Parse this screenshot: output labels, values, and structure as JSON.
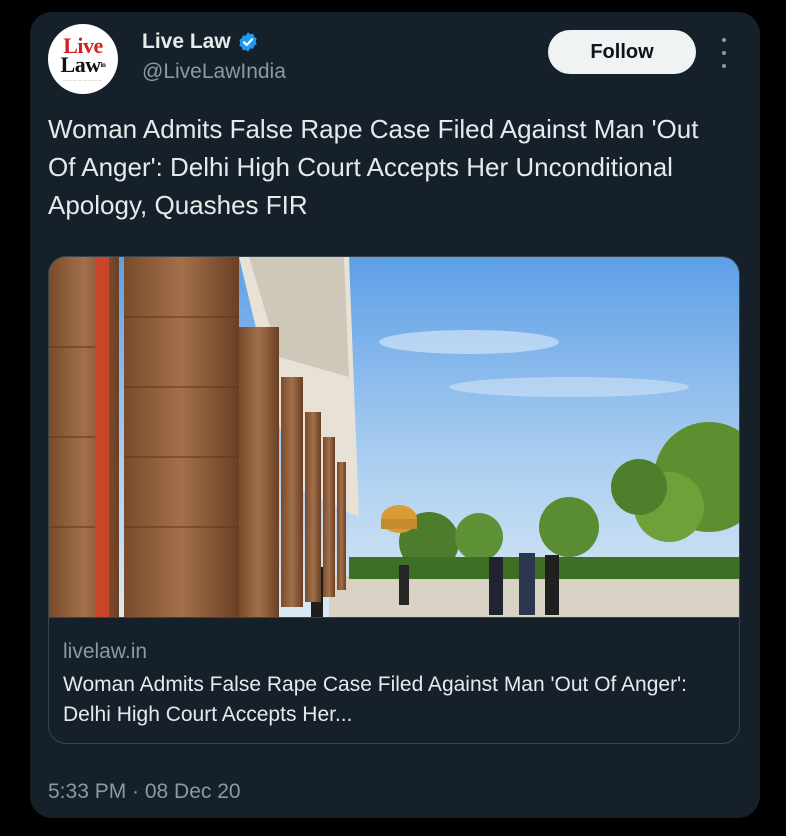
{
  "account": {
    "logo_line1": "Live",
    "logo_line2": "Law",
    "logo_suffix": "in",
    "display_name": "Live Law",
    "handle": "@LiveLawIndia",
    "verified_icon": "verified-badge-icon"
  },
  "actions": {
    "follow_label": "Follow",
    "more_icon": "more-vertical-icon"
  },
  "tweet": {
    "text": "Woman Admits False Rape Case Filed Against Man 'Out Of Anger': Delhi High Court Accepts Her Unconditional Apology, Quashes FIR",
    "timestamp": "5:33 PM · 08 Dec 20"
  },
  "link_card": {
    "domain": "livelaw.in",
    "title": "Woman Admits False Rape Case Filed Against Man 'Out Of Anger': Delhi High Court Accepts Her..."
  },
  "colors": {
    "background": "#15202b",
    "text_primary": "#e7e9ea",
    "text_secondary": "#8b98a5",
    "verified_blue": "#1d9bf0",
    "follow_bg": "#eff3f4",
    "logo_red": "#d11f26"
  }
}
